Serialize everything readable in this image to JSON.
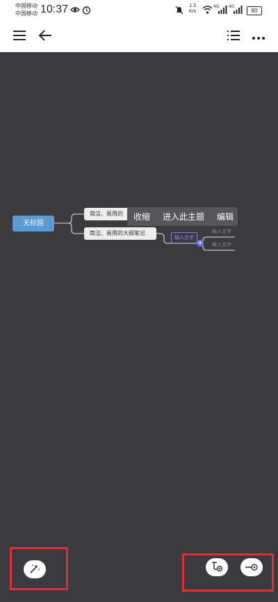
{
  "status_bar": {
    "carrier_1": "中国移动",
    "carrier_2": "中国移动",
    "time": "10:37",
    "net_speed_value": "1.3",
    "net_speed_unit": "K/s",
    "signal_1": "4G",
    "signal_2": "4G",
    "battery": "80",
    "icons": [
      "eye-icon",
      "alarm-icon",
      "mute-icon",
      "wifi-icon",
      "signal-icon",
      "signal-icon",
      "battery-icon"
    ]
  },
  "toolbar": {
    "icons": [
      "menu-icon",
      "back-arrow-icon",
      "outline-list-icon",
      "more-icon"
    ]
  },
  "mindmap": {
    "root": "无标题",
    "child_1": "简洁、易用的",
    "child_2": "简洁、易用的大纲笔记",
    "input_node": "输入文字",
    "ghost_node_1": "输入文字",
    "ghost_node_2": "输入文字"
  },
  "context_menu": {
    "collapse": "收缩",
    "enter_topic": "进入此主题",
    "edit": "编辑"
  },
  "bottom_actions": {
    "icons": [
      "magic-wand-icon",
      "add-subtopic-icon",
      "add-sibling-icon"
    ]
  },
  "colors": {
    "canvas": "#3a3a3f",
    "root_node": "#5b9bd5",
    "highlight": "#e0303a",
    "accent": "#6b6fe0"
  }
}
